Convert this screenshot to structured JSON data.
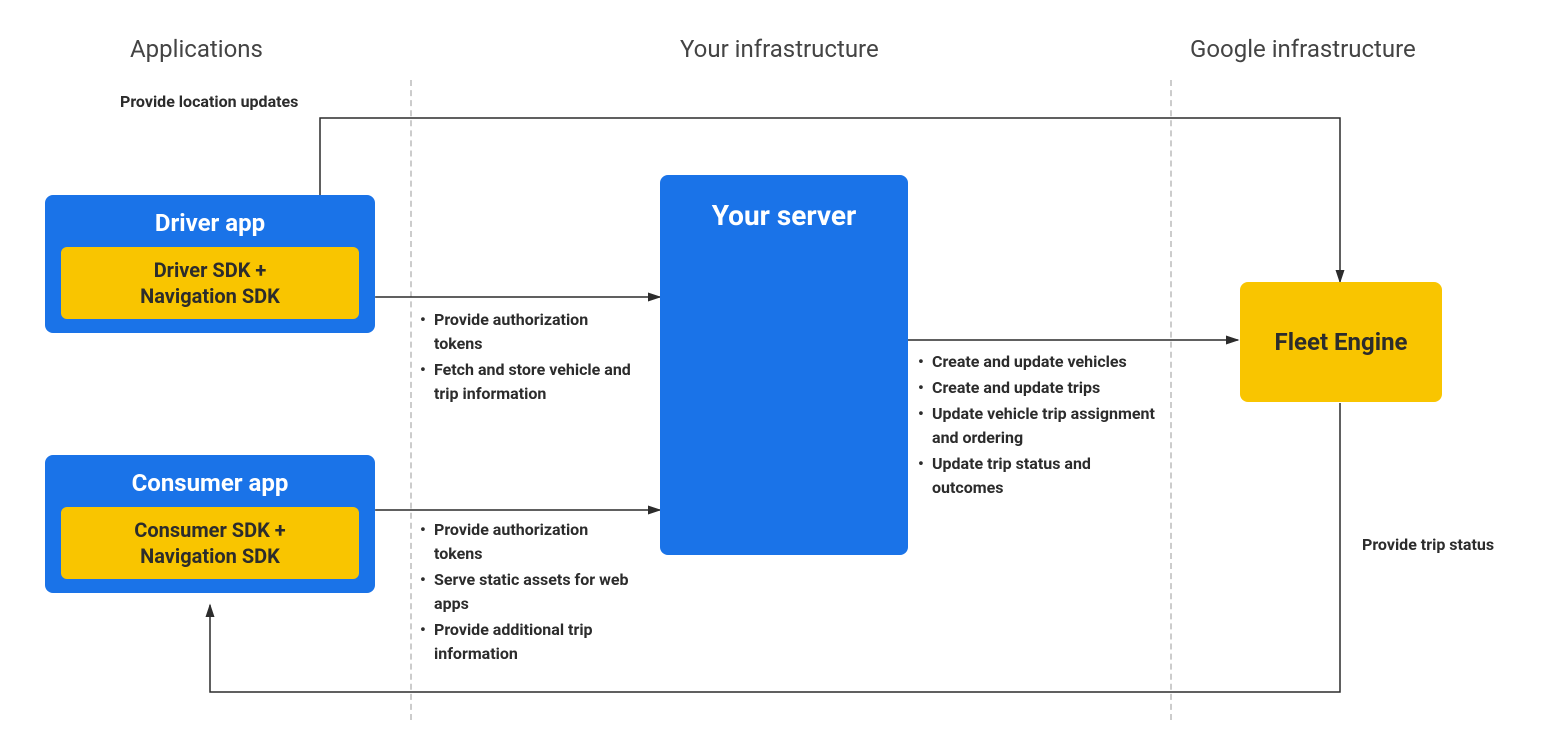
{
  "sections": {
    "applications": "Applications",
    "your_infra": "Your infrastructure",
    "google_infra": "Google infrastructure"
  },
  "boxes": {
    "driver_app": {
      "title": "Driver app",
      "sdk": "Driver SDK +\nNavigation SDK"
    },
    "consumer_app": {
      "title": "Consumer app",
      "sdk": "Consumer SDK +\nNavigation SDK"
    },
    "your_server": "Your server",
    "fleet_engine": "Fleet Engine"
  },
  "labels": {
    "top": "Provide location updates",
    "bottom": "Provide trip status",
    "driver_server": [
      "Provide authorization tokens",
      "Fetch and store vehicle and trip information"
    ],
    "consumer_server": [
      "Provide authorization tokens",
      "Serve static assets for web apps",
      "Provide additional trip information"
    ],
    "server_fleet": [
      "Create and update vehicles",
      "Create and update trips",
      "Update vehicle trip assignment and ordering",
      "Update trip status and outcomes"
    ]
  }
}
